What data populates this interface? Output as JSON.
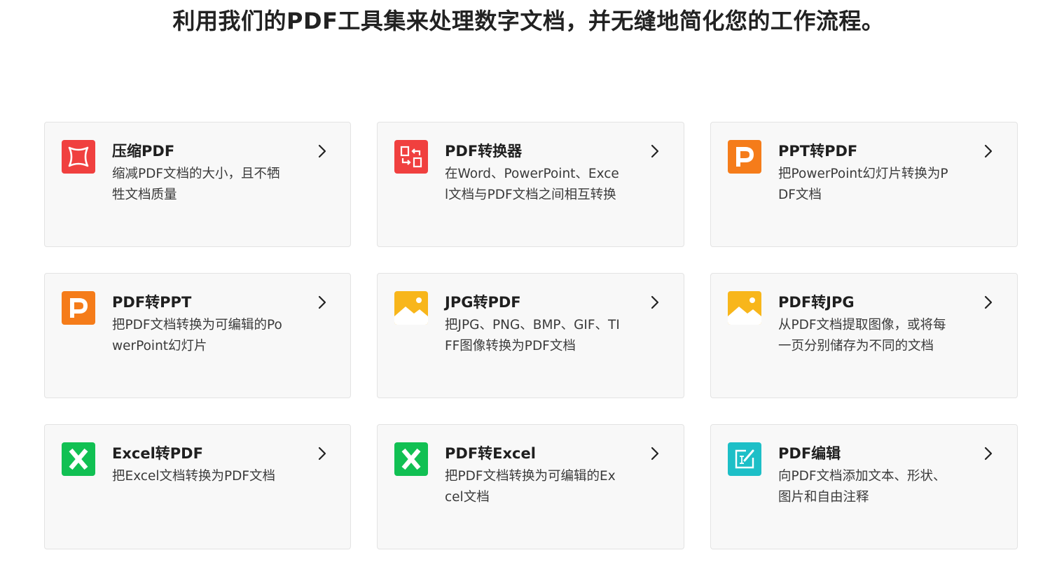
{
  "headline": "利用我们的PDF工具集来处理数字文档，并无缝地简化您的工作流程。",
  "colors": {
    "compress": "#f0403f",
    "convert": "#f0403f",
    "ppt": "#f57c1a",
    "image": "#f8b61b",
    "excel": "#11c053",
    "edit": "#1dbfc7",
    "card_bg": "#f8f8f8",
    "card_border": "#e3e3e3"
  },
  "tools": [
    {
      "name": "tool-card-compress-pdf",
      "icon": "compress-icon",
      "title": "压缩PDF",
      "description": "缩减PDF文档的大小，且不牺牲文档质量"
    },
    {
      "name": "tool-card-pdf-converter",
      "icon": "convert-icon",
      "title": "PDF转换器",
      "description": "在Word、PowerPoint、Excel文档与PDF文档之间相互转换"
    },
    {
      "name": "tool-card-ppt-to-pdf",
      "icon": "powerpoint-icon",
      "title": "PPT转PDF",
      "description": "把PowerPoint幻灯片转换为PDF文档"
    },
    {
      "name": "tool-card-pdf-to-ppt",
      "icon": "powerpoint-icon",
      "title": "PDF转PPT",
      "description": "把PDF文档转换为可编辑的PowerPoint幻灯片"
    },
    {
      "name": "tool-card-jpg-to-pdf",
      "icon": "image-icon",
      "title": "JPG转PDF",
      "description": "把JPG、PNG、BMP、GIF、TIFF图像转换为PDF文档"
    },
    {
      "name": "tool-card-pdf-to-jpg",
      "icon": "image-icon",
      "title": "PDF转JPG",
      "description": "从PDF文档提取图像，或将每一页分别储存为不同的文档"
    },
    {
      "name": "tool-card-excel-to-pdf",
      "icon": "excel-icon",
      "title": "Excel转PDF",
      "description": "把Excel文档转换为PDF文档"
    },
    {
      "name": "tool-card-pdf-to-excel",
      "icon": "excel-icon",
      "title": "PDF转Excel",
      "description": "把PDF文档转换为可编辑的Excel文档"
    },
    {
      "name": "tool-card-pdf-edit",
      "icon": "edit-icon",
      "title": "PDF编辑",
      "description": "向PDF文档添加文本、形状、图片和自由注释"
    }
  ]
}
